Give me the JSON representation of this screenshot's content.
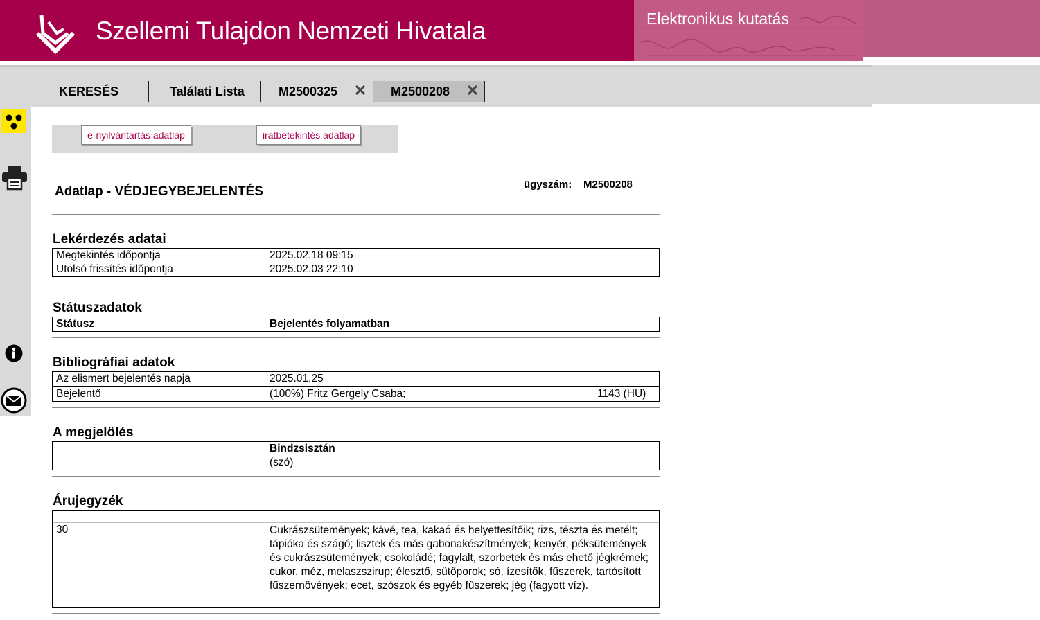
{
  "header": {
    "site_title": "Szellemi Tulajdon Nemzeti Hivatala",
    "subtitle": "Elektronikus kutatás",
    "accent_color": "#a7004a"
  },
  "tabs": {
    "search": "KERESÉS",
    "results": "Találati Lista",
    "case1": "M2500325",
    "case2": "M2500208"
  },
  "toolbar": {
    "icons": [
      "accessibility-icon",
      "print-icon",
      "info-icon",
      "email-icon"
    ]
  },
  "buttons": {
    "e_registry": "e-nyilvántartás adatlap",
    "file_view": "iratbetekintés adatlap"
  },
  "page": {
    "title": "Adatlap - VÉDJEGYBEJELENTÉS",
    "case_label": "ügyszám:",
    "case_number": "M2500208"
  },
  "query": {
    "title": "Lekérdezés adatai",
    "rows": [
      {
        "label": "Megtekintés időpontja",
        "value": "2025.02.18 09:15"
      },
      {
        "label": "Utolsó frissítés időpontja",
        "value": "2025.02.03 22:10"
      }
    ]
  },
  "status": {
    "title": "Státuszadatok",
    "label": "Státusz",
    "value": "Bejelentés folyamatban"
  },
  "biblio": {
    "title": "Bibliográfiai adatok",
    "filing_label": "Az elismert bejelentés napja",
    "filing_value": "2025.01.25",
    "applicant_label": "Bejelentő",
    "applicant_value": "(100%) Fritz Gergely Csaba;",
    "applicant_address": "1143 (HU)"
  },
  "mark": {
    "title": "A megjelölés",
    "name": "Bindzsisztán",
    "kind": "(szó)"
  },
  "goods": {
    "title": "Árujegyzék",
    "class": "30",
    "text": "Cukrászsütemények; kávé, tea, kakaó és helyettesítőik; rizs, tészta és metélt; tápióka és szágó; lisztek és más gabonakészítmények; kenyér, péksütemények és cukrászsütemények; csokoládé; fagylalt, szorbetek és más ehető jégkrémek; cukor, méz, melaszszirup; élesztő, sütőporok; só, ízesítők, fűszerek, tartósított fűszernövények; ecet, szószok és egyéb fűszerek; jég (fagyott víz)."
  }
}
